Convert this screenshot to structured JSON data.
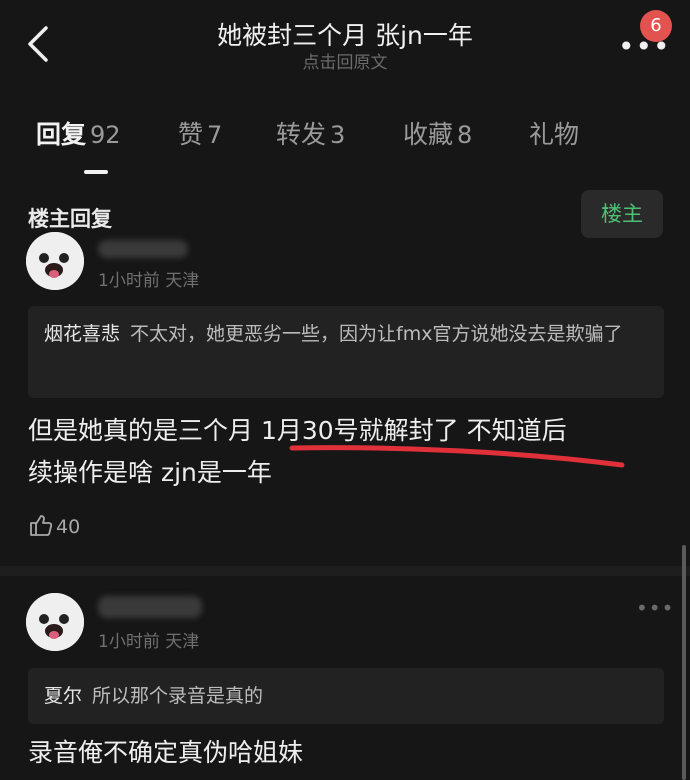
{
  "header": {
    "title": "她被封三个月 张jn一年",
    "subtitle": "点击回原文",
    "badge_count": "6",
    "more_label": "•••"
  },
  "tabs": [
    {
      "label": "回复",
      "count": "92",
      "active": true
    },
    {
      "label": "赞",
      "count": "7",
      "active": false
    },
    {
      "label": "转发",
      "count": "3",
      "active": false
    },
    {
      "label": "收藏",
      "count": "8",
      "active": false
    },
    {
      "label": "礼物",
      "count": "",
      "active": false
    }
  ],
  "section": {
    "title": "楼主回复",
    "op_button": "楼主"
  },
  "comments": [
    {
      "time": "1小时前",
      "location": "天津",
      "quote_name": "烟花喜悲",
      "quote_text": "不太对，她更恶劣一些，因为让fmx官方说她没去是欺骗了",
      "body_line1": "但是她真的是三个月  1月30号就解封了 不知道后",
      "body_line2": "续操作是啥 zjn是一年",
      "likes": "40"
    },
    {
      "time": "1小时前",
      "location": "天津",
      "quote_name": "夏尔",
      "quote_text": "所以那个录音是真的",
      "body_line1": "录音俺不确定真伪哈姐妹",
      "more_label": "•••"
    }
  ],
  "colors": {
    "background": "#161616",
    "op_green": "#4fbf74",
    "badge_red": "#e2524e",
    "highlight_red": "#e0313a"
  }
}
